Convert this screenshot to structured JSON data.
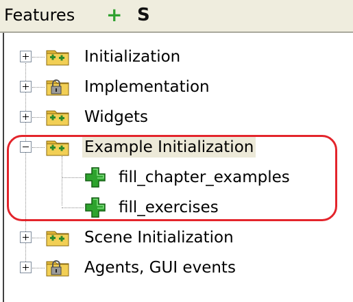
{
  "header": {
    "title": "Features",
    "add_symbol": "+",
    "s_label": "S",
    "add_color": "#2fa12f"
  },
  "tree": {
    "items": [
      {
        "label": "Initialization",
        "icon": "feature-folder-icon",
        "expanded": false
      },
      {
        "label": "Implementation",
        "icon": "locked-folder-icon",
        "expanded": false
      },
      {
        "label": "Widgets",
        "icon": "feature-folder-icon",
        "expanded": false
      },
      {
        "label": "Example Initialization",
        "icon": "feature-folder-icon",
        "expanded": true,
        "selected": true,
        "children": [
          {
            "label": "fill_chapter_examples",
            "icon": "green-plus-icon"
          },
          {
            "label": "fill_exercises",
            "icon": "green-plus-icon"
          }
        ]
      },
      {
        "label": "Scene Initialization",
        "icon": "feature-folder-icon",
        "expanded": false
      },
      {
        "label": "Agents, GUI events",
        "icon": "locked-folder-icon",
        "expanded": false
      }
    ]
  },
  "highlight_color": "#e3242b"
}
